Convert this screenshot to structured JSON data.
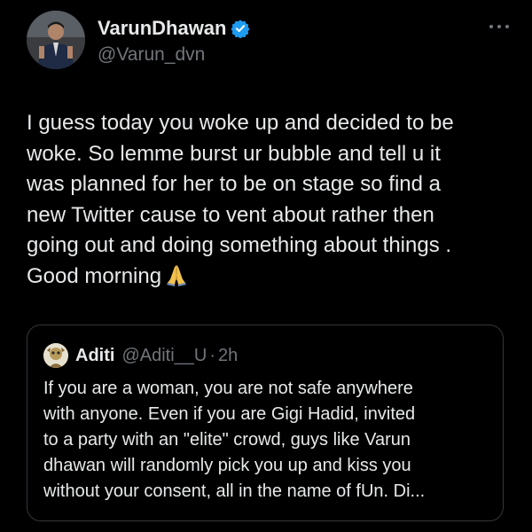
{
  "author": {
    "name": "VarunDhawan",
    "handle": "@Varun_dvn",
    "verified_color": "#1d9bf0"
  },
  "tweet": {
    "lines": [
      "I guess today you woke up and decided to be",
      "woke. So lemme burst ur bubble and tell u it",
      "was planned for her to be on stage so find a",
      "new Twitter cause to vent about rather then",
      "going out and doing something about things .",
      "Good morning"
    ],
    "emoji": "folded-hands-icon"
  },
  "quote": {
    "name": "Aditi",
    "handle": "@Aditi__U",
    "separator": "·",
    "time": "2h",
    "lines": [
      "If you are a woman, you are not safe anywhere",
      "with anyone. Even if you are Gigi Hadid, invited",
      "to a party with an \"elite\" crowd, guys like Varun",
      "dhawan will randomly pick you up and kiss you",
      "without your consent, all in the name of fUn. Di..."
    ]
  },
  "colors": {
    "background": "#000000",
    "text": "#e7e9ea",
    "secondary": "#71767b",
    "border": "#333639"
  }
}
